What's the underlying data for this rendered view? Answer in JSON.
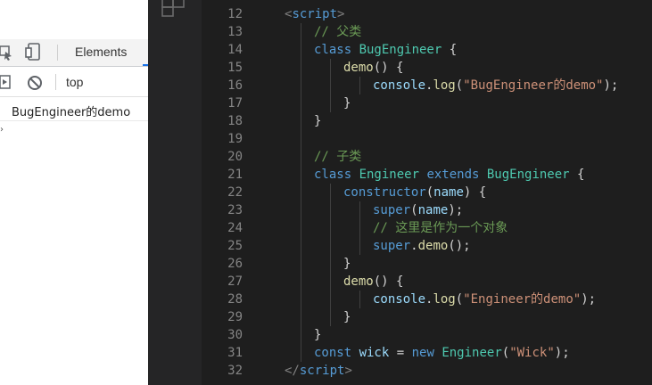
{
  "devtools": {
    "tab_elements": "Elements",
    "context_selector": "top",
    "console_log": "BugEngineer的demo",
    "prompt_symbol": "›"
  },
  "editor": {
    "lines": [
      {
        "n": "12",
        "indent": 1,
        "tokens": [
          [
            "br",
            "<"
          ],
          [
            "tag",
            "script"
          ],
          [
            "br",
            ">"
          ]
        ]
      },
      {
        "n": "13",
        "indent": 2,
        "tokens": [
          [
            "cm",
            "// 父类"
          ]
        ]
      },
      {
        "n": "14",
        "indent": 2,
        "tokens": [
          [
            "kw",
            "class "
          ],
          [
            "cls",
            "BugEngineer"
          ],
          [
            "p",
            " {"
          ]
        ]
      },
      {
        "n": "15",
        "indent": 3,
        "tokens": [
          [
            "fn",
            "demo"
          ],
          [
            "p",
            "() {"
          ]
        ]
      },
      {
        "n": "16",
        "indent": 4,
        "tokens": [
          [
            "id",
            "console"
          ],
          [
            "p",
            "."
          ],
          [
            "fn",
            "log"
          ],
          [
            "p",
            "("
          ],
          [
            "str",
            "\"BugEngineer的demo\""
          ],
          [
            "p",
            ");"
          ]
        ]
      },
      {
        "n": "17",
        "indent": 3,
        "tokens": [
          [
            "p",
            "}"
          ]
        ]
      },
      {
        "n": "18",
        "indent": 2,
        "tokens": [
          [
            "p",
            "}"
          ]
        ]
      },
      {
        "n": "19",
        "indent": 0,
        "tokens": []
      },
      {
        "n": "20",
        "indent": 2,
        "tokens": [
          [
            "cm",
            "// 子类"
          ]
        ]
      },
      {
        "n": "21",
        "indent": 2,
        "tokens": [
          [
            "kw",
            "class "
          ],
          [
            "cls",
            "Engineer "
          ],
          [
            "kw",
            "extends "
          ],
          [
            "cls",
            "BugEngineer"
          ],
          [
            "p",
            " {"
          ]
        ]
      },
      {
        "n": "22",
        "indent": 3,
        "tokens": [
          [
            "kw",
            "constructor"
          ],
          [
            "p",
            "("
          ],
          [
            "id",
            "name"
          ],
          [
            "p",
            ") {"
          ]
        ]
      },
      {
        "n": "23",
        "indent": 4,
        "tokens": [
          [
            "kw",
            "super"
          ],
          [
            "p",
            "("
          ],
          [
            "id",
            "name"
          ],
          [
            "p",
            ");"
          ]
        ]
      },
      {
        "n": "24",
        "indent": 4,
        "tokens": [
          [
            "cm",
            "// 这里是作为一个对象"
          ]
        ]
      },
      {
        "n": "25",
        "indent": 4,
        "tokens": [
          [
            "kw",
            "super"
          ],
          [
            "p",
            "."
          ],
          [
            "fn",
            "demo"
          ],
          [
            "p",
            "();"
          ]
        ]
      },
      {
        "n": "26",
        "indent": 3,
        "tokens": [
          [
            "p",
            "}"
          ]
        ]
      },
      {
        "n": "27",
        "indent": 3,
        "tokens": [
          [
            "fn",
            "demo"
          ],
          [
            "p",
            "() {"
          ]
        ]
      },
      {
        "n": "28",
        "indent": 4,
        "tokens": [
          [
            "id",
            "console"
          ],
          [
            "p",
            "."
          ],
          [
            "fn",
            "log"
          ],
          [
            "p",
            "("
          ],
          [
            "str",
            "\"Engineer的demo\""
          ],
          [
            "p",
            ");"
          ]
        ]
      },
      {
        "n": "29",
        "indent": 3,
        "tokens": [
          [
            "p",
            "}"
          ]
        ]
      },
      {
        "n": "30",
        "indent": 2,
        "tokens": [
          [
            "p",
            "}"
          ]
        ]
      },
      {
        "n": "31",
        "indent": 2,
        "tokens": [
          [
            "kw",
            "const "
          ],
          [
            "id",
            "wick"
          ],
          [
            "p",
            " = "
          ],
          [
            "kw",
            "new "
          ],
          [
            "cls",
            "Engineer"
          ],
          [
            "p",
            "("
          ],
          [
            "str",
            "\"Wick\""
          ],
          [
            "p",
            ");"
          ]
        ]
      },
      {
        "n": "32",
        "indent": 1,
        "tokens": [
          [
            "br",
            "</"
          ],
          [
            "tag",
            "script"
          ],
          [
            "br",
            ">"
          ]
        ]
      }
    ]
  },
  "colors": {
    "editor_bg": "#1e1e1e",
    "keyword": "#569cd6",
    "class": "#4ec9b0",
    "function": "#dcdcaa",
    "identifier": "#9cdcfe",
    "string": "#ce9178",
    "comment": "#6a9955"
  }
}
